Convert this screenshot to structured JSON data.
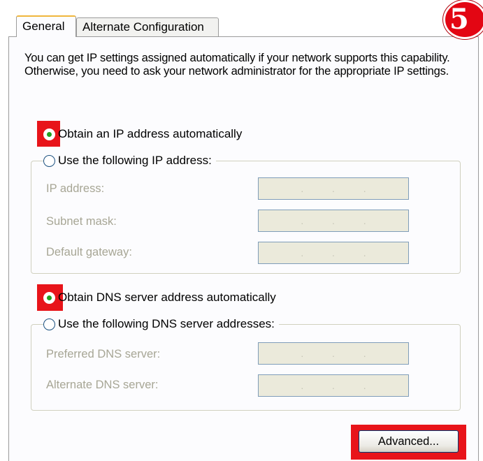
{
  "tabs": [
    {
      "label": "General",
      "selected": true
    },
    {
      "label": "Alternate Configuration",
      "selected": false
    }
  ],
  "intro_text": "You can get IP settings assigned automatically if your network supports this capability. Otherwise, you need to ask your network administrator for the appropriate IP settings.",
  "ip": {
    "auto_label": "Obtain an IP address automatically",
    "manual_label": "Use the following IP address:",
    "auto_selected": true,
    "fields": [
      {
        "label": "IP address:",
        "value": ""
      },
      {
        "label": "Subnet mask:",
        "value": ""
      },
      {
        "label": "Default gateway:",
        "value": ""
      }
    ]
  },
  "dns": {
    "auto_label": "Obtain DNS server address automatically",
    "manual_label": "Use the following DNS server addresses:",
    "auto_selected": true,
    "fields": [
      {
        "label": "Preferred DNS server:",
        "value": ""
      },
      {
        "label": "Alternate DNS server:",
        "value": ""
      }
    ]
  },
  "advanced_label": "Advanced...",
  "step_badge": "5",
  "colors": {
    "highlight": "#e8141a",
    "badge": "#e30613",
    "radio_dot": "#21a121"
  }
}
